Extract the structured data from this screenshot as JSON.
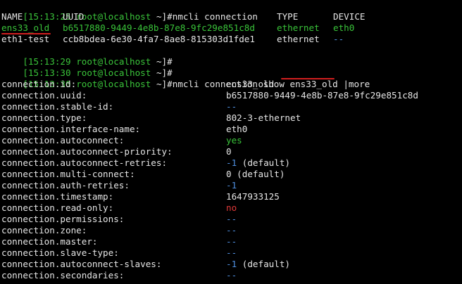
{
  "prompts": [
    {
      "time": "[15:13:25",
      "user": "root@localhost",
      "path": "~]#",
      "cmd": "nmcli connection"
    },
    {
      "time": "[15:13:29",
      "user": "root@localhost",
      "path": "~]#",
      "cmd": ""
    },
    {
      "time": "[15:13:30",
      "user": "root@localhost",
      "path": "~]#",
      "cmd": ""
    },
    {
      "time": "[15:13:30",
      "user": "root@localhost",
      "path": "~]#",
      "cmd_prefix": "nmcli connection show ",
      "cmd_arg": "ens33_old",
      "cmd_suffix": " |more"
    }
  ],
  "table": {
    "headers": [
      "NAME",
      "UUID",
      "TYPE",
      "DEVICE"
    ],
    "rows": [
      {
        "name": "ens33_old",
        "uuid": "b6517880-9449-4e8b-87e8-9fc29e851c8d",
        "type": "ethernet",
        "device": "eth0"
      },
      {
        "name": "eth1-test",
        "uuid": "ccb8bdea-6e30-4fa7-8ae8-815303d1fde1",
        "type": "ethernet",
        "device": "--"
      }
    ]
  },
  "properties": [
    {
      "key": "connection.id:",
      "value": "ens33_old"
    },
    {
      "key": "connection.uuid:",
      "value": "b6517880-9449-4e8b-87e8-9fc29e851c8d"
    },
    {
      "key": "connection.stable-id:",
      "value": "--"
    },
    {
      "key": "connection.type:",
      "value": "802-3-ethernet"
    },
    {
      "key": "connection.interface-name:",
      "value": "eth0"
    },
    {
      "key": "connection.autoconnect:",
      "value": "yes"
    },
    {
      "key": "connection.autoconnect-priority:",
      "value": "0"
    },
    {
      "key": "connection.autoconnect-retries:",
      "value": "-1",
      "suffix": " (default)"
    },
    {
      "key": "connection.multi-connect:",
      "value": "0 (default)"
    },
    {
      "key": "connection.auth-retries:",
      "value": "-1"
    },
    {
      "key": "connection.timestamp:",
      "value": "1647933125"
    },
    {
      "key": "connection.read-only:",
      "value": "no"
    },
    {
      "key": "connection.permissions:",
      "value": "--"
    },
    {
      "key": "connection.zone:",
      "value": "--"
    },
    {
      "key": "connection.master:",
      "value": "--"
    },
    {
      "key": "connection.slave-type:",
      "value": "--"
    },
    {
      "key": "connection.autoconnect-slaves:",
      "value": "-1",
      "suffix": " (default)"
    },
    {
      "key": "connection.secondaries:",
      "value": "--"
    }
  ],
  "colors": {
    "background": "#000000",
    "text": "#e6e6e6",
    "prompt": "#3ac43a",
    "path": "#4fb6d6",
    "dim_value": "#4f8fe0",
    "false_value": "#e03838",
    "annotation_underline": "#d21f1f"
  }
}
